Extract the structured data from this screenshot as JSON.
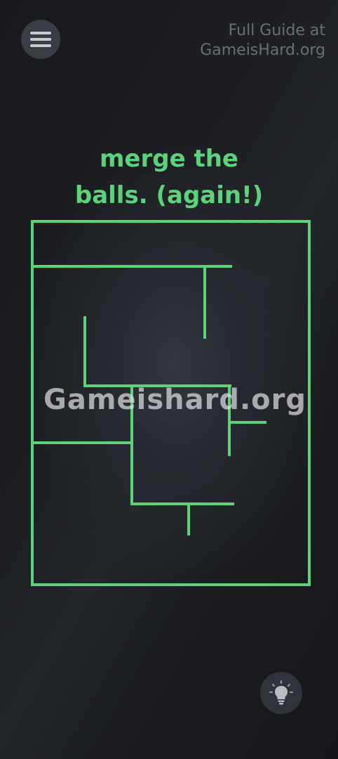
{
  "header": {
    "guide_line1": "Full Guide at",
    "guide_line2": "GameisHard.org"
  },
  "level": {
    "title_line1": "merge the",
    "title_line2": "balls. (again!)"
  },
  "watermark": "Gameishard.org",
  "icons": {
    "menu": "hamburger-menu-icon",
    "hint": "lightbulb-icon"
  },
  "colors": {
    "accent_green": "#5cd37a",
    "wall_green": "#5cd37a",
    "background": "#1d1f23",
    "button_bg": "#3a3d43"
  }
}
